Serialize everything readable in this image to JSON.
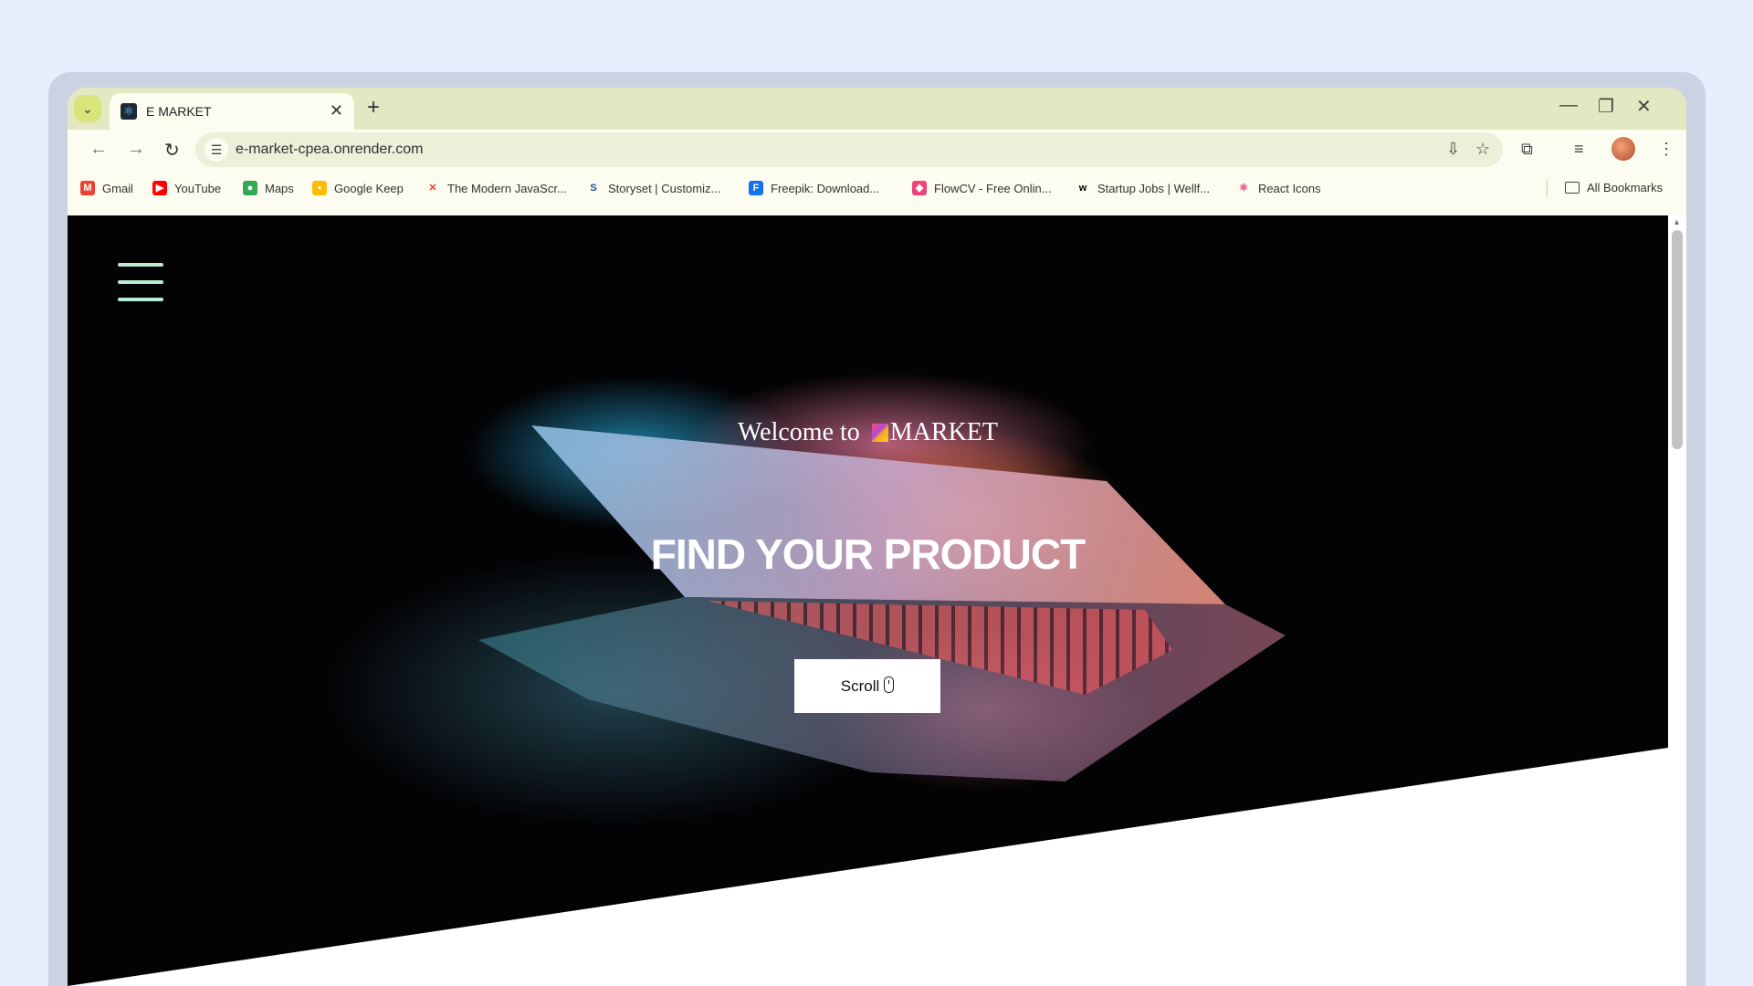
{
  "tab": {
    "title": "E MARKET",
    "close": "✕",
    "new_tab": "+"
  },
  "window_controls": {
    "minimize": "—",
    "restore": "❐",
    "close": "✕"
  },
  "toolbar": {
    "back": "←",
    "forward": "→",
    "reload": "↻"
  },
  "address_bar": {
    "url": "e-market-cpea.onrender.com"
  },
  "bookmarks": [
    {
      "label": "Gmail",
      "icon": "gmail-icon",
      "color": "#ea4335"
    },
    {
      "label": "YouTube",
      "icon": "youtube-icon",
      "color": "#ff0000"
    },
    {
      "label": "Maps",
      "icon": "maps-icon",
      "color": "#34a853"
    },
    {
      "label": "Google Keep",
      "icon": "keep-icon",
      "color": "#fbbc04"
    },
    {
      "label": "The Modern JavaScr...",
      "icon": "js-info-icon",
      "color": "#e8453c"
    },
    {
      "label": "Storyset | Customiz...",
      "icon": "storyset-icon",
      "color": "#1f4fa0"
    },
    {
      "label": "Freepik: Download...",
      "icon": "freepik-icon",
      "color": "#1273eb"
    },
    {
      "label": "FlowCV - Free Onlin...",
      "icon": "flowcv-icon",
      "color": "#f0437a"
    },
    {
      "label": "Startup Jobs | Wellf...",
      "icon": "wellfound-icon",
      "color": "#000000"
    },
    {
      "label": "React Icons",
      "icon": "react-icon",
      "color": "#e0457b"
    }
  ],
  "all_bookmarks": "All Bookmarks",
  "hero": {
    "welcome_prefix": "Welcome to",
    "brand": "MARKET",
    "headline": "FIND YOUR PRODUCT",
    "scroll_button": "Scroll"
  },
  "colors": {
    "accent_hamburger": "#b9ecd6",
    "tabstrip": "#e3e8c2",
    "page_bg": "#e8eefc"
  }
}
